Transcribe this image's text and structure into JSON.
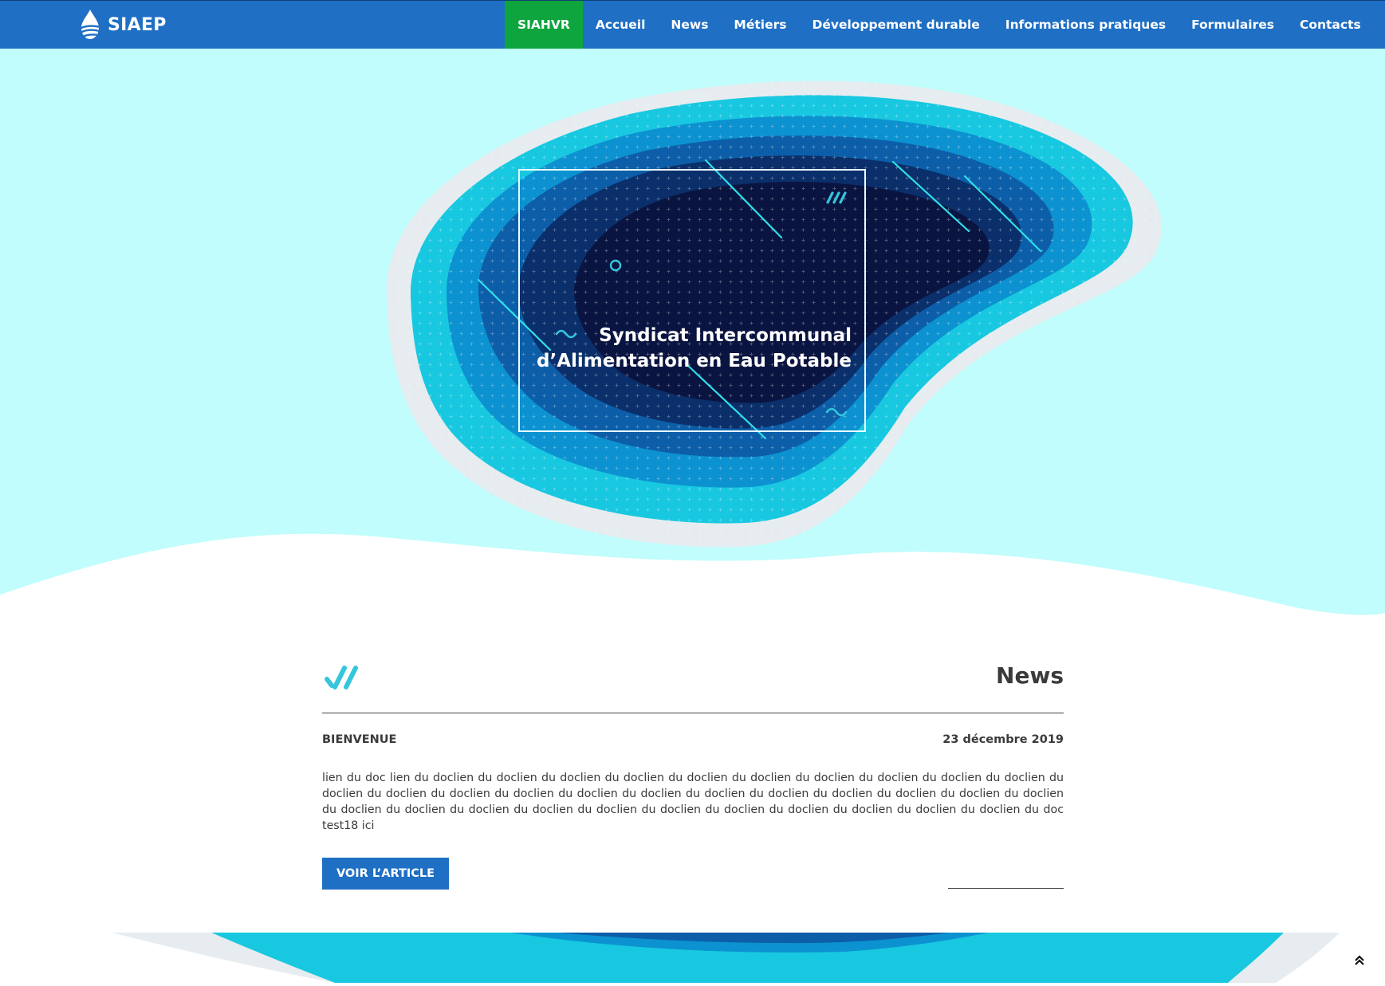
{
  "brand": {
    "name": "SIAEP",
    "icon": "water-drop-logo-icon"
  },
  "nav": {
    "items": [
      {
        "label": "SIAHVR",
        "active": true
      },
      {
        "label": "Accueil",
        "active": false
      },
      {
        "label": "News",
        "active": false
      },
      {
        "label": "Métiers",
        "active": false
      },
      {
        "label": "Développement durable",
        "active": false
      },
      {
        "label": "Informations pratiques",
        "active": false
      },
      {
        "label": "Formulaires",
        "active": false
      },
      {
        "label": "Contacts",
        "active": false
      }
    ]
  },
  "hero": {
    "title_line1": "Syndicat Intercommunal",
    "title_line2": "d’Alimentation en Eau Potable"
  },
  "news": {
    "heading": "News",
    "article": {
      "label": "BIENVENUE",
      "date": "23 décembre 2019",
      "body": "lien du doc lien du doclien du doclien du doclien du doclien du doclien du doclien du doclien du doclien du doclien du doclien du doclien du doclien du doclien du doclien du doclien du doclien du doclien du doclien du doclien du doclien du doclien du doclien du doclien du doclien du doclien du doclien du doclien du doclien du doclien du doclien du doclien du doclien du doclien du doc test18 ici",
      "button_label": "VOIR L’ARTICLE"
    }
  },
  "colors": {
    "nav_bg": "#1f6fc4",
    "active_nav": "#0ea43e",
    "hero_bg": "#c0fdfc",
    "accent_cyan": "#35c6dc",
    "button_bg": "#1f6fc4"
  },
  "icons": {
    "scroll_top": "double-chevron-up-icon"
  }
}
